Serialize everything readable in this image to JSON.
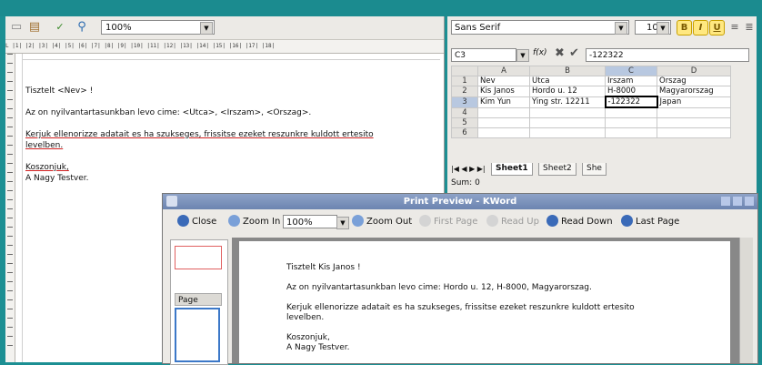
{
  "kword": {
    "zoom": "100%",
    "ruler": "L  |1|  |2|  |3|  |4|  |5|  |6|  |7|  |8|  |9|  |10|  |11|  |12|  |13|  |14|  |15|  |16|  |17|  |18|",
    "doc": {
      "line1": "Tisztelt <Nev> !",
      "line2": "Az on nyilvantartasunkban levo cime: <Utca>, <Irszam>, <Orszag>.",
      "line3a": "Kerjuk ellenorizze adatait es ha szukseges, frissitse ezeket reszunkre kuldott ertesito",
      "line3b": "levelben.",
      "line4a": "Koszonjuk,",
      "line4b": "A Nagy Testver."
    }
  },
  "kspread": {
    "font": "Sans Serif",
    "size": "10",
    "bold": "B",
    "italic": "I",
    "underline": "U",
    "cell_ref": "C3",
    "formula_label": "f(x)",
    "formula": "-122322",
    "columns": [
      "A",
      "B",
      "C",
      "D"
    ],
    "rows": [
      [
        "1",
        "Nev",
        "Utca",
        "Irszam",
        "Orszag"
      ],
      [
        "2",
        "Kis Janos",
        "Hordo u. 12",
        "H-8000",
        "Magyarorszag"
      ],
      [
        "3",
        "Kim Yun",
        "Ying str. 12211",
        "-122322",
        "Japan"
      ],
      [
        "4",
        "",
        "",
        "",
        ""
      ],
      [
        "5",
        "",
        "",
        "",
        ""
      ],
      [
        "6",
        "",
        "",
        "",
        ""
      ]
    ],
    "sheets": [
      "Sheet1",
      "Sheet2",
      "She"
    ],
    "sum": "Sum: 0"
  },
  "preview": {
    "title": "Print Preview - KWord",
    "close": "Close",
    "zoom_in": "Zoom In",
    "zoom": "100%",
    "zoom_out": "Zoom Out",
    "first_page": "First Page",
    "read_up": "Read Up",
    "read_down": "Read Down",
    "last_page": "Last Page",
    "page_label": "Page",
    "page": {
      "line1": "Tisztelt Kis Janos !",
      "line2": "Az on nyilvantartasunkban levo cime: Hordo u. 12, H-8000, Magyarorszag.",
      "line3a": "Kerjuk ellenorizze adatait es ha szukseges, frissitse ezeket reszunkre kuldott ertesito",
      "line3b": "levelben.",
      "line4a": "Koszonjuk,",
      "line4b": "A Nagy Testver."
    }
  }
}
